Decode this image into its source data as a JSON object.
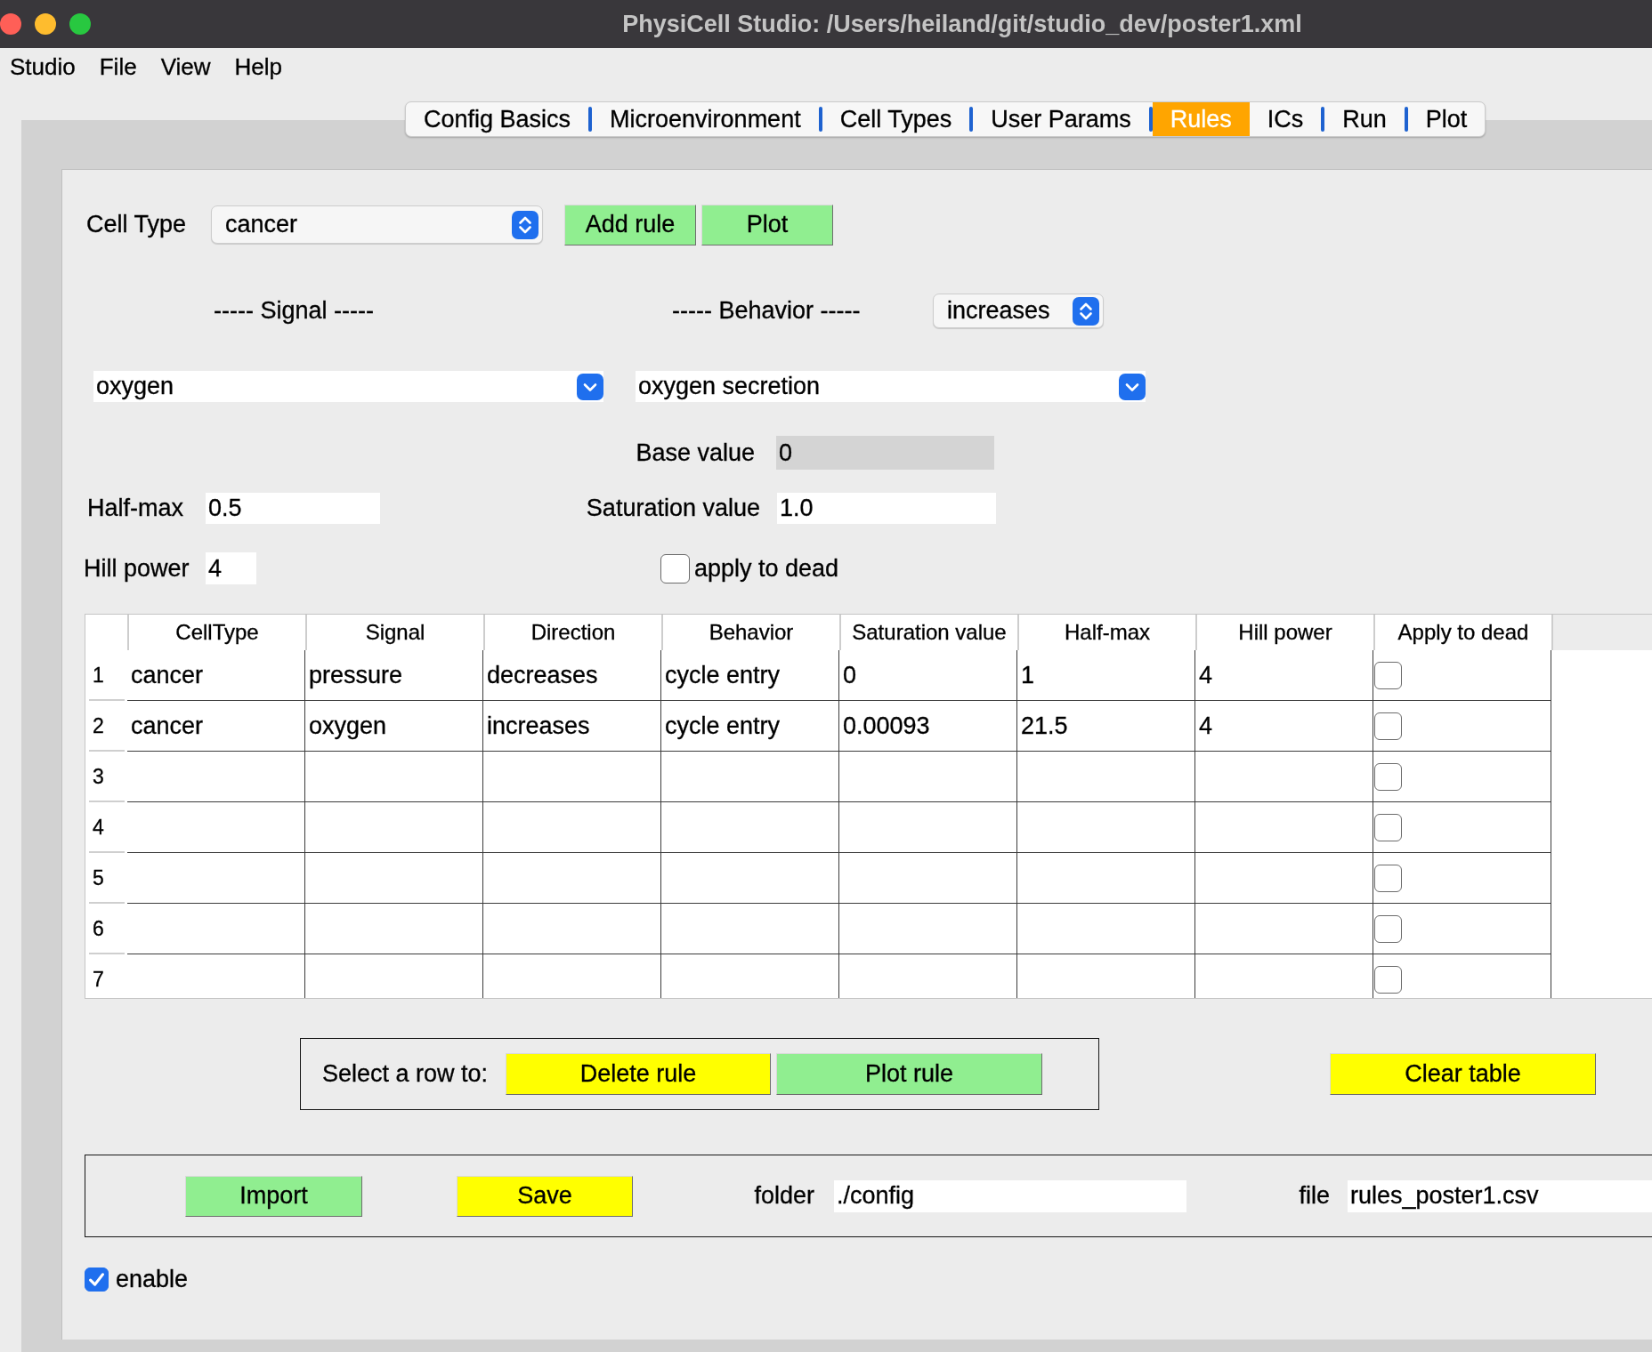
{
  "window": {
    "title": "PhysiCell Studio: /Users/heiland/git/studio_dev/poster1.xml"
  },
  "menu": [
    "Studio",
    "File",
    "View",
    "Help"
  ],
  "tabs": [
    {
      "label": "Config Basics",
      "selected": false
    },
    {
      "label": "Microenvironment",
      "selected": false
    },
    {
      "label": "Cell Types",
      "selected": false
    },
    {
      "label": "User Params",
      "selected": false
    },
    {
      "label": "Rules",
      "selected": true
    },
    {
      "label": "ICs",
      "selected": false
    },
    {
      "label": "Run",
      "selected": false
    },
    {
      "label": "Plot",
      "selected": false
    }
  ],
  "rule_editor": {
    "cell_type": {
      "label": "Cell Type",
      "value": "cancer"
    },
    "buttons": [
      {
        "label": "Add rule",
        "color": "#90ee90"
      },
      {
        "label": "Plot",
        "color": "#90ee90"
      }
    ],
    "signal_heading": "----- Signal -----",
    "behavior_heading": "----- Behavior -----",
    "direction": {
      "value": "increases"
    },
    "signal": {
      "value": "oxygen"
    },
    "behavior": {
      "value": "oxygen secretion"
    },
    "base_value": {
      "label": "Base value",
      "value": "0",
      "disabled": true
    },
    "half_max": {
      "label": "Half-max",
      "value": "0.5"
    },
    "saturation_value": {
      "label": "Saturation value",
      "value": "1.0"
    },
    "hill_power": {
      "label": "Hill power",
      "value": "4"
    },
    "apply_to_dead": {
      "label": "apply to dead",
      "checked": false
    }
  },
  "rules_table": {
    "columns": [
      "CellType",
      "Signal",
      "Direction",
      "Behavior",
      "Saturation value",
      "Half-max",
      "Hill power",
      "Apply to dead"
    ],
    "rows": [
      {
        "number": "1",
        "cells": [
          "cancer",
          "pressure",
          "decreases",
          "cycle entry",
          "0",
          "1",
          "4"
        ],
        "apply_to_dead": false
      },
      {
        "number": "2",
        "cells": [
          "cancer",
          "oxygen",
          "increases",
          "cycle entry",
          "0.00093",
          "21.5",
          "4"
        ],
        "apply_to_dead": false
      },
      {
        "number": "3",
        "apply_to_dead": false
      },
      {
        "number": "4",
        "apply_to_dead": false
      },
      {
        "number": "5",
        "apply_to_dead": false
      },
      {
        "number": "6",
        "apply_to_dead": false
      },
      {
        "number": "7",
        "apply_to_dead": false
      }
    ]
  },
  "row_actions": {
    "label": "Select a row to:",
    "buttons": [
      {
        "label": "Delete rule",
        "color": "#ffff00"
      },
      {
        "label": "Plot rule",
        "color": "#90ee90"
      }
    ]
  },
  "clear_table": {
    "label": "Clear table",
    "color": "#ffff00"
  },
  "file_panel": {
    "buttons": [
      {
        "label": "Import",
        "color": "#90ee90"
      },
      {
        "label": "Save",
        "color": "#ffff00"
      }
    ],
    "folder": {
      "label": "folder",
      "value": "./config"
    },
    "file": {
      "label": "file",
      "value": "rules_poster1.csv"
    }
  },
  "enable": {
    "label": "enable",
    "checked": true
  }
}
